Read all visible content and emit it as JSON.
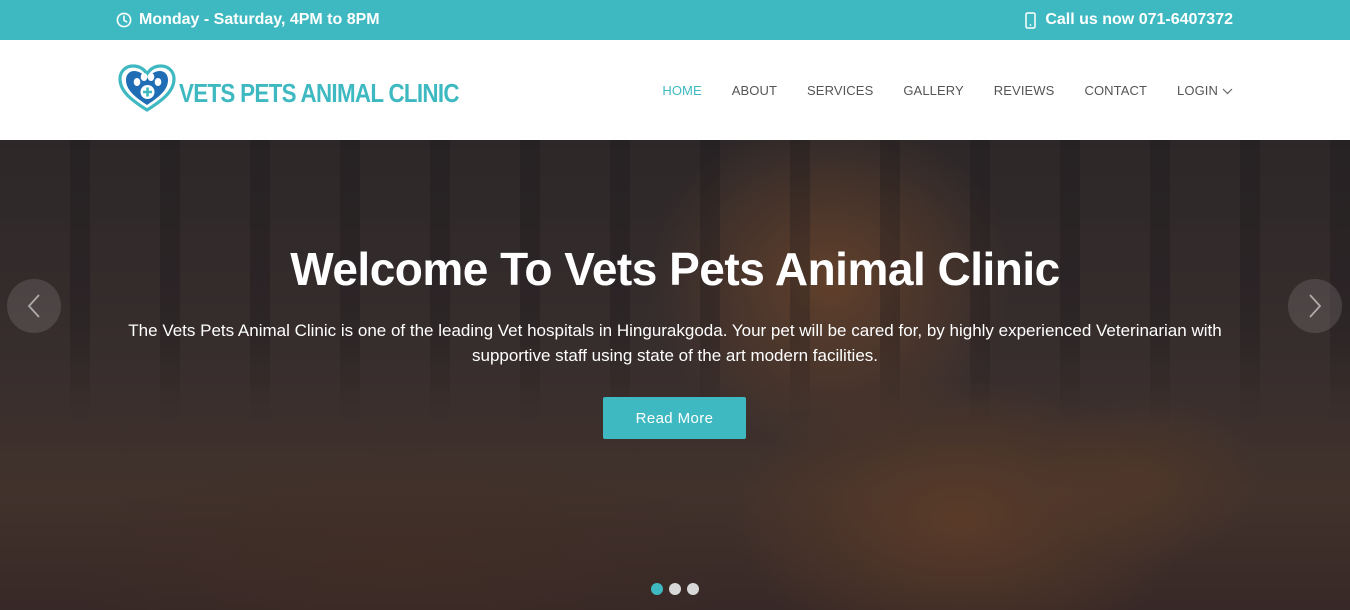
{
  "topbar": {
    "hours_icon": "clock-icon",
    "hours": "Monday - Saturday, 4PM to 8PM",
    "phone_icon": "mobile-phone-icon",
    "phone": "Call us now 071-6407372"
  },
  "logo": {
    "icon": "heart-paw-cross-icon",
    "text": "VETS PETS ANIMAL CLINIC"
  },
  "nav": {
    "items": [
      {
        "label": "HOME",
        "active": true
      },
      {
        "label": "ABOUT"
      },
      {
        "label": "SERVICES"
      },
      {
        "label": "GALLERY"
      },
      {
        "label": "REVIEWS"
      },
      {
        "label": "CONTACT"
      },
      {
        "label": "LOGIN",
        "dropdown_icon": "chevron-down-icon"
      }
    ]
  },
  "hero": {
    "title": "Welcome To Vets Pets Animal Clinic",
    "text": "The Vets Pets Animal Clinic is one of the leading Vet hospitals in Hingurakgoda. Your pet will be cared for, by highly experienced Veterinarian with supportive staff using state of the art modern facilities.",
    "button": "Read More",
    "prev_icon": "chevron-left-icon",
    "next_icon": "chevron-right-icon",
    "slides": 3,
    "active_slide": 1
  },
  "colors": {
    "accent": "#3fb9c1",
    "nav_text": "#555555",
    "logo_dark": "#1f6db5"
  }
}
